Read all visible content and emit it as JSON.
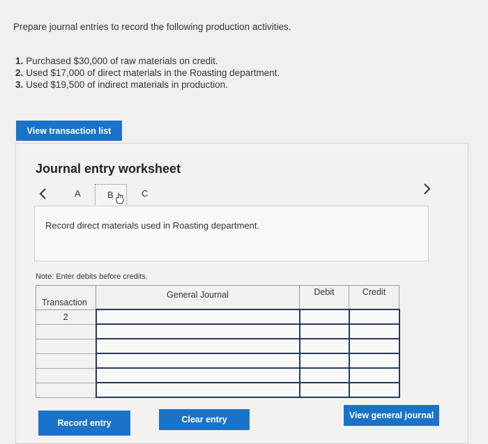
{
  "instructions": {
    "prompt": "Prepare journal entries to record the following production activities.",
    "tasks": [
      {
        "num": "1.",
        "text": "Purchased $30,000 of raw materials on credit."
      },
      {
        "num": "2.",
        "text": "Used $17,000 of direct materials in the Roasting department."
      },
      {
        "num": "3.",
        "text": "Used $19,500 of indirect materials in production."
      }
    ]
  },
  "view_list_label": "View transaction list",
  "worksheet": {
    "title": "Journal entry worksheet",
    "prev_icon": "chevron-left-icon",
    "next_icon": "chevron-right-icon",
    "tabs": [
      "A",
      "B",
      "C"
    ],
    "active_tab": "B",
    "description": "Record direct materials used in Roasting department.",
    "note": "Note: Enter debits before credits.",
    "table": {
      "headers": {
        "transaction": "Transaction",
        "general_journal": "General Journal",
        "debit": "Debit",
        "credit": "Credit"
      },
      "rows": [
        {
          "transaction": "2",
          "account": "",
          "debit": "",
          "credit": ""
        },
        {
          "transaction": "",
          "account": "",
          "debit": "",
          "credit": ""
        },
        {
          "transaction": "",
          "account": "",
          "debit": "",
          "credit": ""
        },
        {
          "transaction": "",
          "account": "",
          "debit": "",
          "credit": ""
        },
        {
          "transaction": "",
          "account": "",
          "debit": "",
          "credit": ""
        },
        {
          "transaction": "",
          "account": "",
          "debit": "",
          "credit": ""
        }
      ]
    },
    "buttons": {
      "record": "Record entry",
      "clear": "Clear entry",
      "view_general_journal": "View general journal"
    }
  },
  "colors": {
    "button_blue": "#1a73c9",
    "field_border": "#233a5c",
    "background": "#f1f0ee"
  }
}
